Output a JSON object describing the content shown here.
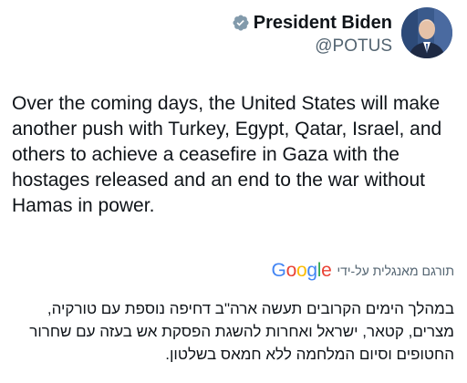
{
  "author": {
    "display_name": "President Biden",
    "handle": "@POTUS",
    "verified_icon": "verified-badge-icon",
    "verified_color": "#829aab"
  },
  "tweet": {
    "text": "Over the coming days, the United States will make another push with Turkey, Egypt, Qatar, Israel, and others to achieve a ceasefire in Gaza with the hostages released and an end to the war without Hamas in power."
  },
  "translation": {
    "provider_logo": "Google",
    "label": "תורגם מאנגלית על-ידי",
    "text": "במהלך הימים הקרובים תעשה ארה\"ב דחיפה נוספת עם טורקיה, מצרים, קטאר, ישראל ואחרות להשגת הפסקת אש בעזה עם שחרור החטופים וסיום המלחמה ללא חמאס בשלטון."
  },
  "colors": {
    "text_primary": "#0f1419",
    "text_secondary": "#536471",
    "google_blue": "#4285F4",
    "google_red": "#EA4335",
    "google_yellow": "#FBBC05",
    "google_green": "#34A853"
  }
}
